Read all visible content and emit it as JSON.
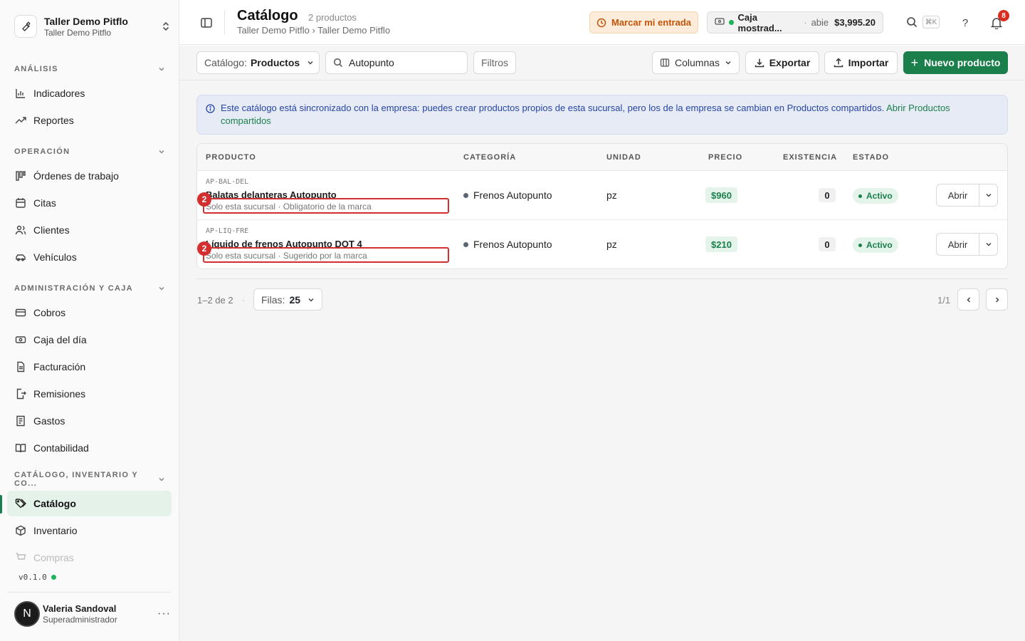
{
  "org": {
    "name": "Taller Demo Pitflo",
    "subtitle": "Taller Demo Pitflo"
  },
  "sidebar": {
    "sections": [
      {
        "label": "ANÁLISIS"
      },
      {
        "label": "OPERACIÓN"
      },
      {
        "label": "ADMINISTRACIÓN Y CAJA"
      },
      {
        "label": "CATÁLOGO, INVENTARIO Y CO..."
      }
    ],
    "items": [
      {
        "label": "Indicadores"
      },
      {
        "label": "Reportes"
      },
      {
        "label": "Órdenes de trabajo"
      },
      {
        "label": "Citas"
      },
      {
        "label": "Clientes"
      },
      {
        "label": "Vehículos"
      },
      {
        "label": "Cobros"
      },
      {
        "label": "Caja del día"
      },
      {
        "label": "Facturación"
      },
      {
        "label": "Remisiones"
      },
      {
        "label": "Gastos"
      },
      {
        "label": "Contabilidad"
      },
      {
        "label": "Catálogo"
      },
      {
        "label": "Inventario"
      },
      {
        "label": "Compras"
      }
    ],
    "version": "v0.1.0"
  },
  "user": {
    "initial": "N",
    "name": "Valeria Sandoval",
    "role": "Superadministrador",
    "more": "···"
  },
  "header": {
    "title": "Catálogo",
    "count": "2 productos",
    "breadcrumb": "Taller Demo Pitflo › Taller Demo Pitflo",
    "entrada_label": "Marcar mi entrada",
    "caja": {
      "name": "Caja mostrad...",
      "sep": "·",
      "status": "abie",
      "amount": "$3,995.20"
    },
    "shortcut": "⌘K",
    "help": "?",
    "notifications": "8"
  },
  "toolbar": {
    "catalog_key": "Catálogo:",
    "catalog_value": "Productos",
    "search_value": "Autopunto",
    "filters_label": "Filtros",
    "columns_label": "Columnas",
    "export_label": "Exportar",
    "import_label": "Importar",
    "new_label": "Nuevo producto"
  },
  "banner": {
    "text": "Este catálogo está sincronizado con la empresa: puedes crear productos propios de esta sucursal, pero los de la empresa se cambian en Productos compartidos.",
    "link": "Abrir Productos compartidos"
  },
  "table": {
    "columns": [
      "PRODUCTO",
      "CATEGORÍA",
      "UNIDAD",
      "PRECIO",
      "EXISTENCIA",
      "ESTADO"
    ],
    "rows": [
      {
        "sku": "AP-BAL-DEL",
        "name": "Balatas delanteras Autopunto",
        "meta": "Solo esta sucursal · Obligatorio de la marca",
        "badge": "2",
        "category": "Frenos Autopunto",
        "unit": "pz",
        "price": "$960",
        "stock": "0",
        "status": "Activo",
        "action": "Abrir"
      },
      {
        "sku": "AP-LIQ-FRE",
        "name": "Líquido de frenos Autopunto DOT 4",
        "meta": "Solo esta sucursal · Sugerido por la marca",
        "badge": "2",
        "category": "Frenos Autopunto",
        "unit": "pz",
        "price": "$210",
        "stock": "0",
        "status": "Activo",
        "action": "Abrir"
      }
    ]
  },
  "pagination": {
    "range": "1–2 de 2",
    "dot": "·",
    "rows_key": "Filas:",
    "rows_value": "25",
    "page": "1/1"
  },
  "colors": {
    "accent": "#1a7f4b",
    "highlight": "#d32f2f",
    "banner_text": "#2545a8",
    "warning": "#c2540a"
  }
}
